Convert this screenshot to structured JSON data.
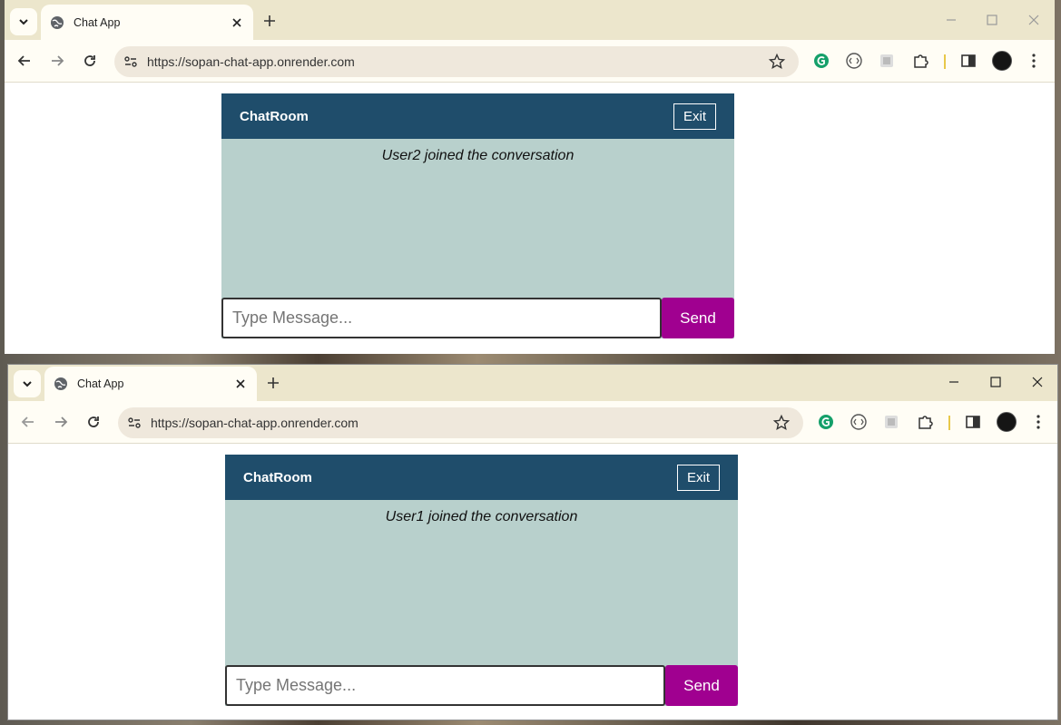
{
  "windows": [
    {
      "tab_title": "Chat App",
      "url": "https://sopan-chat-app.onrender.com",
      "chat": {
        "title": "ChatRoom",
        "exit_label": "Exit",
        "notice": "User2 joined the conversation",
        "input_placeholder": "Type Message...",
        "send_label": "Send"
      }
    },
    {
      "tab_title": "Chat App",
      "url": "https://sopan-chat-app.onrender.com",
      "chat": {
        "title": "ChatRoom",
        "exit_label": "Exit",
        "notice": "User1 joined the conversation",
        "input_placeholder": "Type Message...",
        "send_label": "Send"
      }
    }
  ],
  "colors": {
    "chat_header": "#1f4d6b",
    "chat_body": "#b8d0cc",
    "send_button": "#a00090",
    "titlebar": "#ece6cc"
  }
}
